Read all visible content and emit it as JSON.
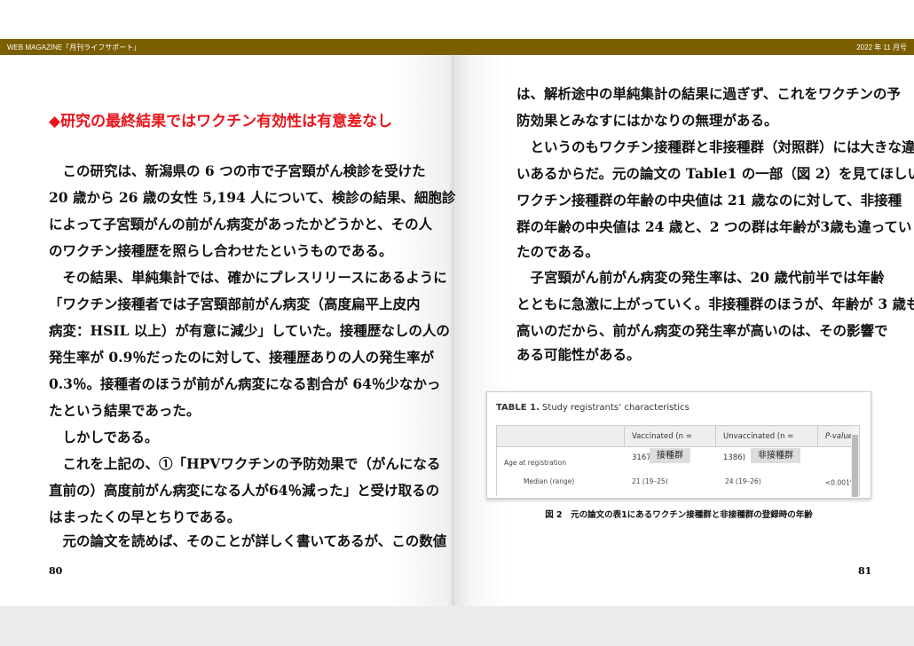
{
  "header": {
    "left": "WEB MAGAZINE「月刊ライフサポート」",
    "right": "2022 年 11 月号"
  },
  "left_page": {
    "heading": "◆研究の最終結果ではワクチン有効性は有意差なし",
    "lines": [
      "この研究は、新潟県の 6 つの市で子宮頸がん検診を受けた",
      "20 歳から 26 歳の女性 5,194 人について、検診の結果、細胞診",
      "によって子宮頸がんの前がん病変があったかどうかと、その人",
      "のワクチン接種歴を照らし合わせたというものである。",
      "その結果、単純集計では、確かにプレスリリースにあるように",
      "「ワクチン接種者では子宮頸部前がん病変（高度扁平上皮内",
      "病変：HSIL 以上）が有意に減少」していた。接種歴なしの人の",
      "発生率が 0.9％だったのに対して、接種歴ありの人の発生率が",
      "0.3％。接種者のほうが前がん病変になる割合が 64％少なかっ",
      "たという結果であった。",
      "しかしである。",
      "これを上記の、①「HPVワクチンの予防効果で（がんになる",
      "直前の）高度前がん病変になる人が64％減った」と受け取るの",
      "はまったくの早とちりである。",
      "元の論文を読めば、そのことが詳しく書いてあるが、この数値"
    ],
    "page_number": "80"
  },
  "right_page": {
    "lines": [
      "は、解析途中の単純集計の結果に過ぎず、これをワクチンの予",
      "防効果とみなすにはかなりの無理がある。",
      "というのもワクチン接種群と非接種群（対照群）には大きな違",
      "いあるからだ。元の論文の Table1 の一部（図 2）を見てほしい。",
      "ワクチン接種群の年齢の中央値は 21 歳なのに対して、非接種",
      "群の年齢の中央値は 24 歳と、2 つの群は年齢が3歳も違ってい",
      "たのである。",
      "子宮頸がん前がん病変の発生率は、20 歳代前半では年齢",
      "とともに急激に上がっていく。非接種群のほうが、年齢が 3 歳も",
      "高いのだから、前がん病変の発生率が高いのは、その影響で",
      "ある可能性がある。"
    ],
    "page_number": "81",
    "figure": {
      "table_label": "TABLE 1.",
      "table_title": "Study registrants’ characteristics",
      "columns": [
        "Vaccinated (n = 3167)",
        "Unvaccinated (n = 1386)",
        "P-value"
      ],
      "tag_vaccinated": "接種群",
      "tag_unvaccinated": "非接種群",
      "row_group": "Age at registration",
      "row": {
        "label": "Median (range)",
        "vaccinated": "21 (19–25)",
        "unvaccinated": "24 (19–26)",
        "p": "<0.001",
        "note": "a"
      },
      "caption": "図 2　元の論文の表1にあるワクチン接種群と非接種群の登録時の年齢"
    }
  }
}
